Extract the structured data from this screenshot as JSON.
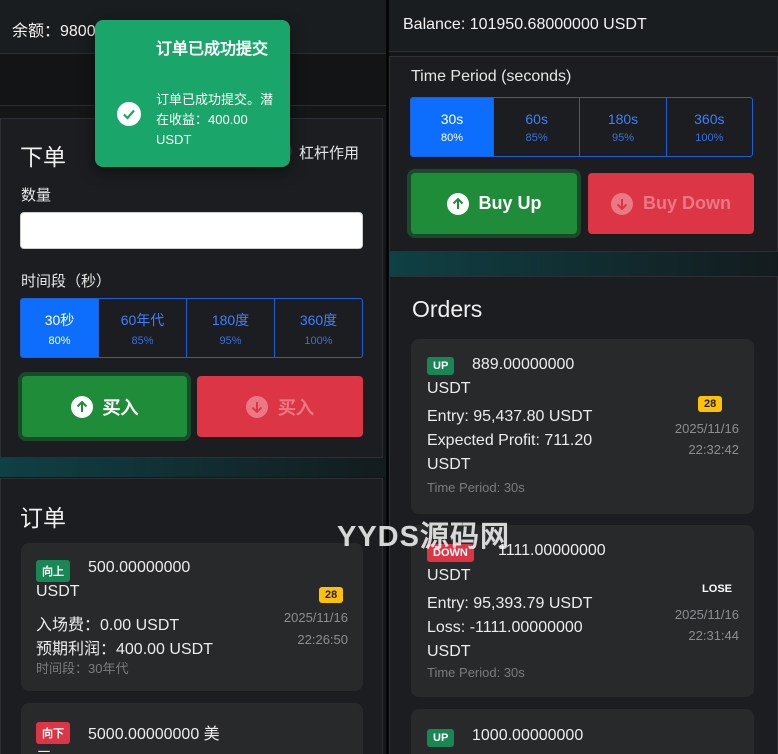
{
  "left": {
    "balance": "余额：98000000000000000 USDT",
    "place_order": {
      "title": "下单",
      "leverage_label": "杠杆作用",
      "quantity_label": "数量",
      "quantity_value": "",
      "period_label": "时间段（秒）",
      "periods": [
        {
          "name": "30秒",
          "pct": "80%"
        },
        {
          "name": "60年代",
          "pct": "85%"
        },
        {
          "name": "180度",
          "pct": "95%"
        },
        {
          "name": "360度",
          "pct": "100%"
        }
      ],
      "buy_up": "买入",
      "buy_down": "买入"
    },
    "orders_title": "订单",
    "orders": [
      {
        "dir": "向上",
        "amount": "500.00000000",
        "unit": "USDT",
        "lev": "28",
        "entry": "入场费：0.00 USDT",
        "profit": "预期利润：400.00 USDT",
        "date": "2025/11/16",
        "time": "22:26:50",
        "period": "时间段：30年代"
      },
      {
        "dir": "向下",
        "amount": "5000.00000000 美",
        "unit": "元"
      }
    ],
    "toast": {
      "title": "订单已成功提交",
      "message": "订单已成功提交。潜在收益：400.00 USDT"
    }
  },
  "right": {
    "balance": "Balance: 101950.68000000 USDT",
    "period_label": "Time Period (seconds)",
    "periods": [
      {
        "name": "30s",
        "pct": "80%"
      },
      {
        "name": "60s",
        "pct": "85%"
      },
      {
        "name": "180s",
        "pct": "95%"
      },
      {
        "name": "360s",
        "pct": "100%"
      }
    ],
    "buy_up": "Buy Up",
    "buy_down": "Buy Down",
    "orders_title": "Orders",
    "orders": [
      {
        "dir": "UP",
        "amount": "889.00000000",
        "unit": "USDT",
        "lev": "28",
        "entry": "Entry: 95,437.80 USDT",
        "profit": "Expected Profit: 711.20",
        "profit_unit": "USDT",
        "date": "2025/11/16",
        "time": "22:32:42",
        "period": "Time Period: 30s"
      },
      {
        "dir": "DOWN",
        "amount": "1111.00000000",
        "unit": "USDT",
        "status": "LOSE",
        "entry": "Entry: 95,393.79 USDT",
        "profit": "Loss: -1111.00000000",
        "profit_unit": "USDT",
        "date": "2025/11/16",
        "time": "22:31:44",
        "period": "Time Period: 30s"
      },
      {
        "dir": "UP",
        "amount": "1000.00000000"
      }
    ]
  },
  "watermark": "YYDS源码网",
  "colors": {
    "accent": "#0d6efd",
    "up": "#1e8c39",
    "down": "#dc3545",
    "toast": "#1aa56a",
    "leverage": "#ffc107"
  }
}
